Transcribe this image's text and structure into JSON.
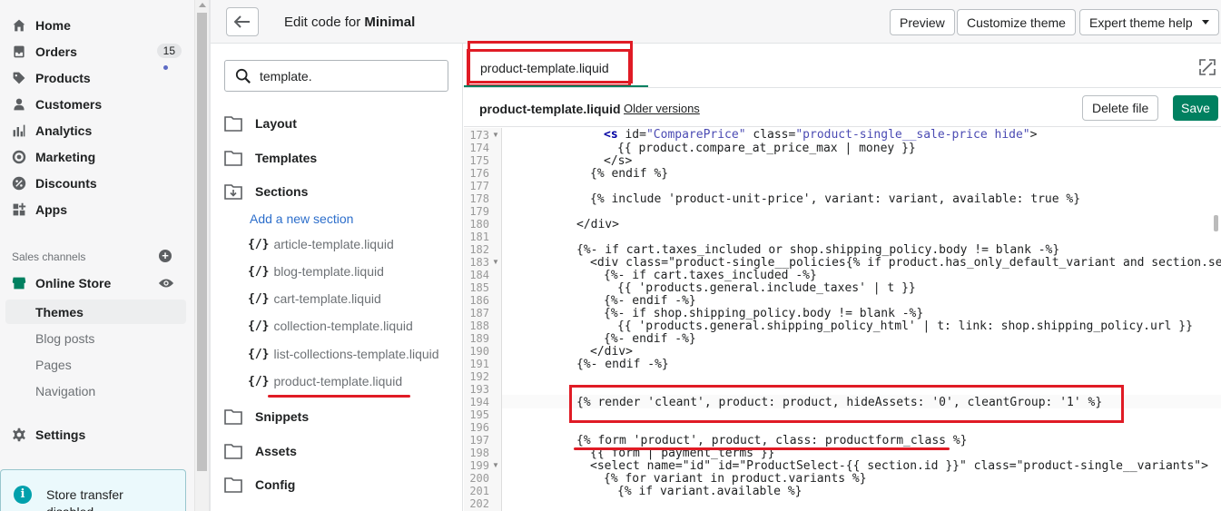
{
  "nav": {
    "items": [
      {
        "label": "Home",
        "icon": "home-icon"
      },
      {
        "label": "Orders",
        "icon": "orders-icon",
        "badge": "15"
      },
      {
        "label": "Products",
        "icon": "tag-icon"
      },
      {
        "label": "Customers",
        "icon": "person-icon"
      },
      {
        "label": "Analytics",
        "icon": "bar-chart-icon"
      },
      {
        "label": "Marketing",
        "icon": "target-icon"
      },
      {
        "label": "Discounts",
        "icon": "percent-icon"
      },
      {
        "label": "Apps",
        "icon": "apps-icon"
      }
    ],
    "sales_channels_label": "Sales channels",
    "online_store": "Online Store",
    "sub_items": [
      "Themes",
      "Blog posts",
      "Pages",
      "Navigation"
    ],
    "settings": "Settings",
    "store_card": {
      "line1": "Store transfer",
      "line2": "disabled"
    }
  },
  "topbar": {
    "title_prefix": "Edit code for",
    "theme_name": "Minimal",
    "preview": "Preview",
    "customize": "Customize theme",
    "expert_help": "Expert theme help"
  },
  "files": {
    "search_value": "template.",
    "folders": [
      "Layout",
      "Templates",
      "Sections",
      "Snippets",
      "Assets",
      "Config"
    ],
    "add_section": "Add a new section",
    "section_files": [
      "article-template.liquid",
      "blog-template.liquid",
      "cart-template.liquid",
      "collection-template.liquid",
      "list-collections-template.liquid",
      "product-template.liquid"
    ],
    "liquid_icon_text": "{/}"
  },
  "editor": {
    "tab_label": "product-template.liquid",
    "file_name": "product-template.liquid",
    "older_versions": "Older versions",
    "delete_file": "Delete file",
    "save": "Save",
    "line_numbers": [
      "173",
      "174",
      "175",
      "176",
      "177",
      "178",
      "179",
      "180",
      "181",
      "182",
      "183",
      "184",
      "185",
      "186",
      "187",
      "188",
      "189",
      "190",
      "191",
      "192",
      "193",
      "194",
      "195",
      "196",
      "197",
      "198",
      "199",
      "200",
      "201",
      "202"
    ],
    "lines": {
      "l173_a": "<s ",
      "l173_b": "id=",
      "l173_c": "\"ComparePrice\"",
      "l173_d": " class=",
      "l173_e": "\"product-single__sale-price hide\"",
      "l173_f": ">",
      "l174": "{{ product.compare_at_price_max | money }}",
      "l175": "</s>",
      "l176": "{% endif %}",
      "l178": "{% include 'product-unit-price', variant: variant, available: true %}",
      "l180": "</div>",
      "l182": "{%- if cart.taxes_included or shop.shipping_policy.body != blank -%}",
      "l183": "<div class=\"product-single__policies{% if product.has_only_default_variant and section.set",
      "l184": "{%- if cart.taxes_included -%}",
      "l185": "{{ 'products.general.include_taxes' | t }}",
      "l186": "{%- endif -%}",
      "l187": "{%- if shop.shipping_policy.body != blank -%}",
      "l188": "{{ 'products.general.shipping_policy_html' | t: link: shop.shipping_policy.url }}",
      "l189": "{%- endif -%}",
      "l190": "</div>",
      "l191": "{%- endif -%}",
      "l194": "{% render 'cleant', product: product, hideAssets: '0', cleantGroup: '1' %}",
      "l197": "{% form 'product', product, class: productform_class %}",
      "l198": "{{ form | payment_terms }}",
      "l199": "<select name=\"id\" id=\"ProductSelect-{{ section.id }}\" class=\"product-single__variants\">",
      "l200": "{% for variant in product.variants %}",
      "l201": "{% if variant.available %}"
    }
  },
  "colors": {
    "accent_green": "#008060",
    "highlight_red": "#e01b25",
    "link_blue": "#2c6ecb"
  }
}
